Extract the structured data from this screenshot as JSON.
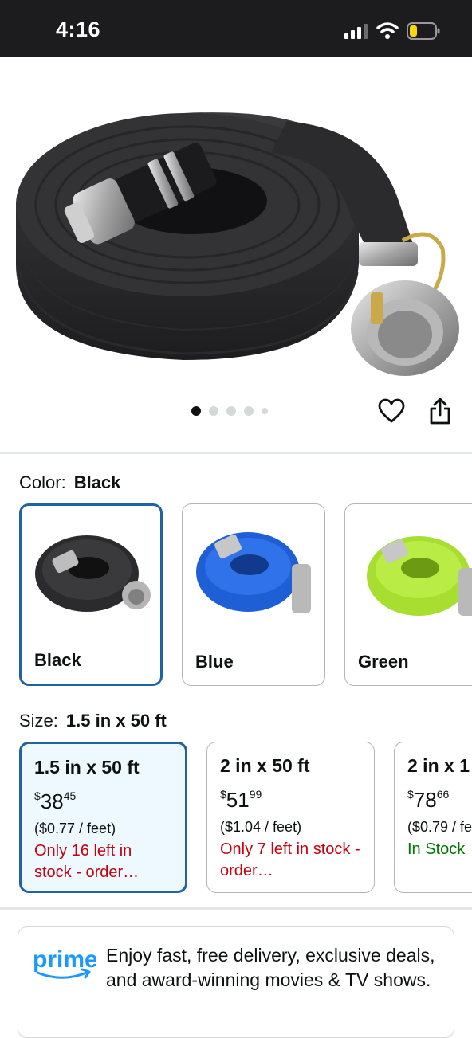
{
  "status_bar": {
    "time": "4:16"
  },
  "gallery": {
    "image_count": 5,
    "active_index": 0
  },
  "color": {
    "label": "Color:",
    "selected": "Black",
    "options": [
      {
        "name": "Black",
        "hex": "#2b2b2b"
      },
      {
        "name": "Blue",
        "hex": "#1f5fd6"
      },
      {
        "name": "Green",
        "hex": "#b3e63a"
      }
    ]
  },
  "size": {
    "label": "Size:",
    "selected": "1.5 in x 50 ft",
    "options": [
      {
        "title": "1.5 in x 50 ft",
        "currency": "$",
        "dollars": "38",
        "cents": "45",
        "unit": "($0.77 / feet)",
        "stock": "Only 16 left in stock - order…"
      },
      {
        "title": "2 in x 50 ft",
        "currency": "$",
        "dollars": "51",
        "cents": "99",
        "unit": "($1.04 / feet)",
        "stock": "Only 7 left in stock - order…"
      },
      {
        "title": "2 in x 1",
        "currency": "$",
        "dollars": "78",
        "cents": "66",
        "unit": "($0.79 / fe",
        "stock": "In Stock"
      }
    ]
  },
  "prime": {
    "logo_text": "prime",
    "message": "Enjoy fast, free delivery, exclusive deals, and award-winning movies & TV shows."
  },
  "colors": {
    "accent": "#2162a1",
    "selected_bg": "#edf8ff",
    "low_stock": "#c7000b",
    "in_stock": "#007600",
    "prime_blue": "#1a98ff"
  }
}
